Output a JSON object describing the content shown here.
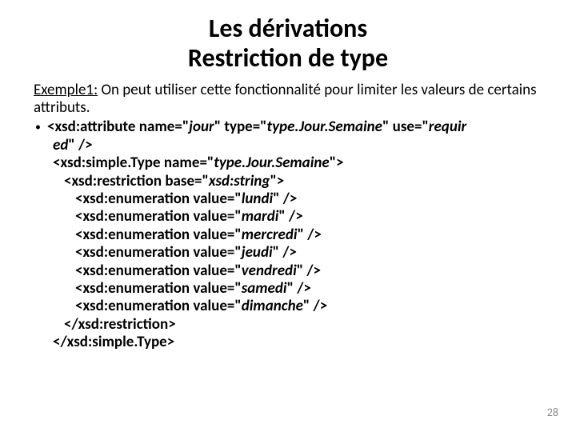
{
  "title": {
    "line1": "Les dérivations",
    "line2": "Restriction de type"
  },
  "intro": {
    "label": "Exemple1:",
    "rest": " On peut utiliser cette fonctionnalité pour limiter les valeurs de certains attributs."
  },
  "code": {
    "l1a": "<xsd:attribute name=\"",
    "l1b": "jour",
    "l1c": "\" type=\"",
    "l1d": "type.Jour.Semaine",
    "l1e": "\" use=\"",
    "l1f": "requir",
    "l2a": "ed",
    "l2b": "\" />",
    "l3a": "<xsd:simple.Type name=\"",
    "l3b": "type.Jour.Semaine",
    "l3c": "\">",
    "l4a": "<xsd:restriction base=\"",
    "l4b": "xsd:string",
    "l4c": "\">",
    "l5a": "<xsd:enumeration value=\"",
    "l5b": "lundi",
    "l5c": "\" />",
    "l6a": "<xsd:enumeration value=\"",
    "l6b": "mardi",
    "l6c": "\" />",
    "l7a": "<xsd:enumeration value=\"",
    "l7b": "mercredi",
    "l7c": "\" />",
    "l8a": "<xsd:enumeration value=\"",
    "l8b": "jeudi",
    "l8c": "\" />",
    "l9a": "<xsd:enumeration value=\"",
    "l9b": "vendredi",
    "l9c": "\" />",
    "l10a": "<xsd:enumeration value=\"",
    "l10b": "samedi",
    "l10c": "\" />",
    "l11a": "<xsd:enumeration value=\"",
    "l11b": "dimanche",
    "l11c": "\" />",
    "l12": "</xsd:restriction>",
    "l13": "</xsd:simple.Type>"
  },
  "page": "28"
}
